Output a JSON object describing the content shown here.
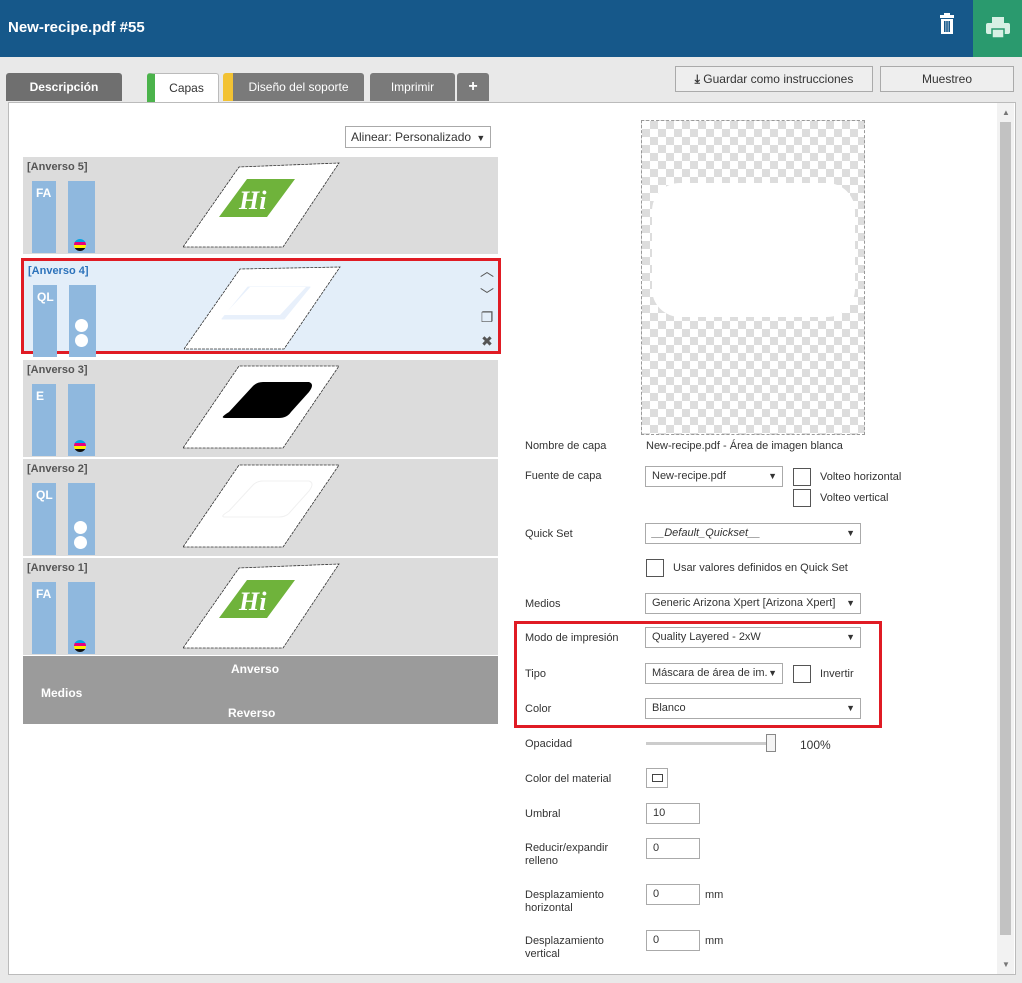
{
  "header": {
    "title": "New-recipe.pdf #55",
    "trash_icon": "trash-icon",
    "print_icon": "printer-icon"
  },
  "tabs": [
    {
      "label": "Descripción"
    },
    {
      "label": "Capas"
    },
    {
      "label": "Diseño del soporte"
    },
    {
      "label": "Imprimir"
    },
    {
      "label": "+"
    }
  ],
  "toolbar": {
    "save_label": "Guardar como instrucciones",
    "sampling_label": "Muestreo"
  },
  "align": {
    "value": "Alinear: Personalizado"
  },
  "layers": [
    {
      "name": "[Anverso 5]",
      "code": "FA"
    },
    {
      "name": "[Anverso 4]",
      "code": "QL"
    },
    {
      "name": "[Anverso 3]",
      "code": "E"
    },
    {
      "name": "[Anverso 2]",
      "code": "QL"
    },
    {
      "name": "[Anverso 1]",
      "code": "FA"
    }
  ],
  "thumb_text": "Hi",
  "media": {
    "label": "Medios",
    "front": "Anverso",
    "back": "Reverso"
  },
  "props": {
    "layer_name_label": "Nombre de capa",
    "layer_name_value": "New-recipe.pdf - Área de imagen blanca",
    "source_label": "Fuente de capa",
    "source_value": "New-recipe.pdf",
    "flip_h": "Volteo horizontal",
    "flip_v": "Volteo vertical",
    "quickset_label": "Quick Set",
    "quickset_value": "__Default_Quickset__",
    "use_quickset": "Usar valores definidos en Quick Set",
    "media_label": "Medios",
    "media_value": "Generic Arizona Xpert [Arizona Xpert]",
    "print_mode_label": "Modo de impresión",
    "print_mode_value": "Quality Layered - 2xW",
    "type_label": "Tipo",
    "type_value": "Máscara de área de im.",
    "invert_label": "Invertir",
    "color_label": "Color",
    "color_value": "Blanco",
    "opacity_label": "Opacidad",
    "opacity_value": "100%",
    "material_color_label": "Color del material",
    "threshold_label": "Umbral",
    "threshold_value": "10",
    "shrink_label_1": "Reducir/expandir",
    "shrink_label_2": "relleno",
    "shrink_value": "0",
    "hoffset_label_1": "Desplazamiento",
    "hoffset_label_2": "horizontal",
    "hoffset_value": "0",
    "voffset_label_1": "Desplazamiento",
    "voffset_label_2": "vertical",
    "voffset_value": "0",
    "unit": "mm"
  },
  "colors": {
    "header": "#16588a",
    "print_btn": "#2a9a6e",
    "highlight": "#e01b24",
    "green_tab": "#4bb34b",
    "yellow_tab": "#f2c233",
    "thumb_green": "#6fb33b"
  }
}
